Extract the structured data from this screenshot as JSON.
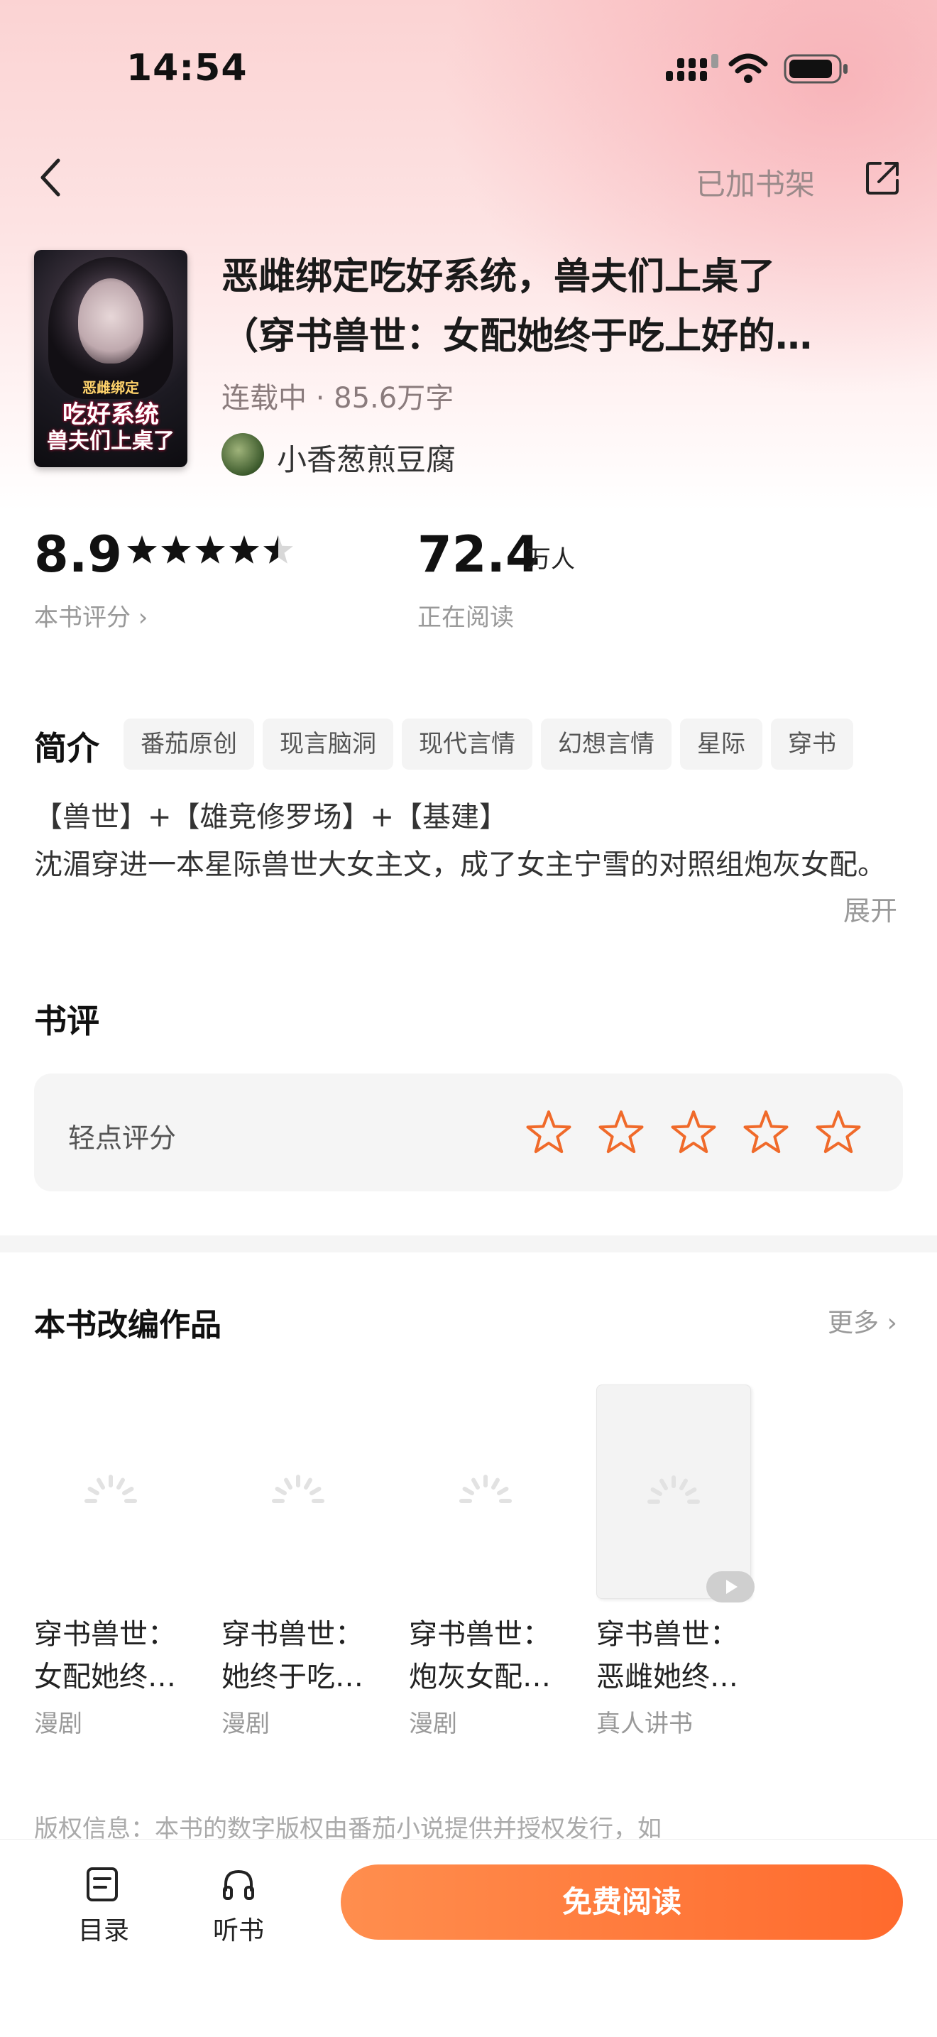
{
  "status_bar": {
    "time": "14:54"
  },
  "nav": {
    "shelf_label": "已加书架"
  },
  "book": {
    "title_line1": "恶雌绑定吃好系统，兽夫们上桌了",
    "title_line2": "（穿书兽世：女配她终于吃上好的…",
    "meta": "连载中 · 85.6万字",
    "author": "小香葱煎豆腐",
    "cover_text": [
      "恶雌绑定",
      "吃好系统",
      "兽夫们上桌了"
    ]
  },
  "stats": {
    "score": "8.9",
    "score_stars": 4.5,
    "score_label": "本书评分 ›",
    "readers": "72.4",
    "readers_unit": "万人",
    "readers_label": "正在阅读"
  },
  "intro": {
    "heading": "简介",
    "tags": [
      "番茄原创",
      "现言脑洞",
      "现代言情",
      "幻想言情",
      "星际",
      "穿书"
    ],
    "line1": "【兽世】+【雄竞修罗场】+【基建】",
    "line2": "沈湄穿进一本星际兽世大女主文，成了女主宁雪的对照组炮灰女配。",
    "expand": "展开"
  },
  "reviews": {
    "heading": "书评",
    "tip": "轻点评分",
    "star_count": 5,
    "accent": "#f06a2a"
  },
  "adaptations": {
    "heading": "本书改编作品",
    "more": "更多 ›",
    "items": [
      {
        "line1": "穿书兽世：",
        "line2": "女配她终…",
        "type": "漫剧"
      },
      {
        "line1": "穿书兽世：",
        "line2": "她终于吃…",
        "type": "漫剧"
      },
      {
        "line1": "穿书兽世：",
        "line2": "炮灰女配…",
        "type": "漫剧"
      },
      {
        "line1": "穿书兽世：",
        "line2": "恶雌她终…",
        "type": "真人讲书"
      }
    ]
  },
  "copyright": "版权信息：本书的数字版权由番茄小说提供并授权发行，如",
  "bottom_bar": {
    "toc_label": "目录",
    "listen_label": "听书",
    "cta_label": "免费阅读"
  }
}
